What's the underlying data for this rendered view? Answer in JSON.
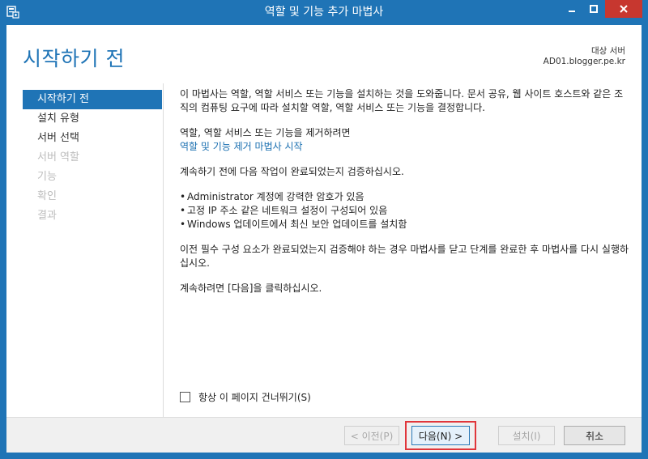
{
  "window": {
    "title": "역할 및 기능 추가 마법사",
    "app_icon": "server-manager-icon"
  },
  "header": {
    "page_title": "시작하기 전",
    "target_label": "대상 서버",
    "target_value": "AD01.blogger.pe.kr"
  },
  "nav": {
    "items": [
      {
        "label": "시작하기 전",
        "state": "active"
      },
      {
        "label": "설치 유형",
        "state": "enabled"
      },
      {
        "label": "서버 선택",
        "state": "enabled"
      },
      {
        "label": "서버 역할",
        "state": "disabled"
      },
      {
        "label": "기능",
        "state": "disabled"
      },
      {
        "label": "확인",
        "state": "disabled"
      },
      {
        "label": "결과",
        "state": "disabled"
      }
    ]
  },
  "main": {
    "intro": "이 마법사는 역할, 역할 서비스 또는 기능을 설치하는 것을 도와줍니다. 문서 공유, 웹 사이트 호스트와 같은 조직의 컴퓨팅 요구에 따라 설치할 역할, 역할 서비스 또는 기능을 결정합니다.",
    "remove_text": "역할, 역할 서비스 또는 기능을 제거하려면",
    "remove_link": "역할 및 기능 제거 마법사 시작",
    "verify_text": "계속하기 전에 다음 작업이 완료되었는지 검증하십시오.",
    "bullets": [
      "Administrator 계정에 강력한 암호가 있음",
      "고정 IP 주소 같은 네트워크 설정이 구성되어 있음",
      "Windows 업데이트에서 최신 보안 업데이트를 설치함"
    ],
    "prereq_text": "이전 필수 구성 요소가 완료되었는지 검증해야 하는 경우 마법사를 닫고 단계를 완료한 후 마법사를 다시 실행하십시오.",
    "continue_text": "계속하려면 [다음]을 클릭하십시오."
  },
  "skip": {
    "label": "항상 이 페이지 건너뛰기(S)",
    "checked": false
  },
  "footer": {
    "prev_label": "< 이전(P)",
    "next_label": "다음(N) >",
    "install_label": "설치(I)",
    "cancel_label": "취소"
  },
  "colors": {
    "accent": "#1f74b6",
    "close_button": "#c7372f",
    "highlight": "#e0363b"
  }
}
